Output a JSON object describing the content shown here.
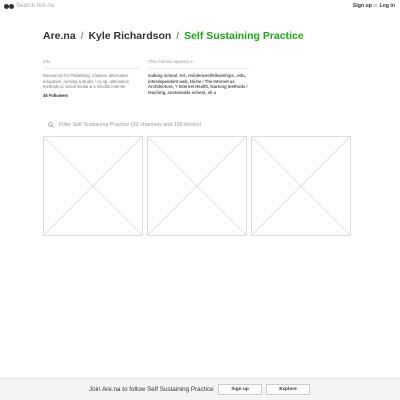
{
  "header": {
    "search_placeholder": "Search Are.na",
    "sign_up": "Sign up",
    "or": "or",
    "log_in": "Log in"
  },
  "breadcrumb": {
    "site": "Are.na",
    "separator": "/",
    "user": "Kyle Richardson",
    "channel": "Self Sustaining Practice"
  },
  "info": {
    "label": "Info",
    "description": "Resources for Publishing, Classes, alternative education, running a studio / co-op, alternative methods to social media & a mindful internet",
    "followers": "46 Followers"
  },
  "appears_in": {
    "label": "This channel appears in",
    "channels": "making school. Art, residences/fellowships, .edu, interdependent web, Niche / The Internet as Architecture, ? Internet Health, learning methods / teaching, sustainable school, ok a"
  },
  "filter": {
    "placeholder": "Filter Self Sustaining Practice (32 channels and 155 blocks)"
  },
  "blocks": [
    {
      "id": "block-1"
    },
    {
      "id": "block-2"
    },
    {
      "id": "block-3"
    }
  ],
  "footer": {
    "text": "Join Are.na to follow Self Sustaining Practice",
    "sign_up_label": "Sign up",
    "explore_label": "Explore"
  },
  "colors": {
    "accent_green": "#17ac10",
    "text": "#333333",
    "muted": "#999999",
    "border": "#dddddd"
  },
  "icons": [
    "arena-logo-icon",
    "search-icon"
  ]
}
